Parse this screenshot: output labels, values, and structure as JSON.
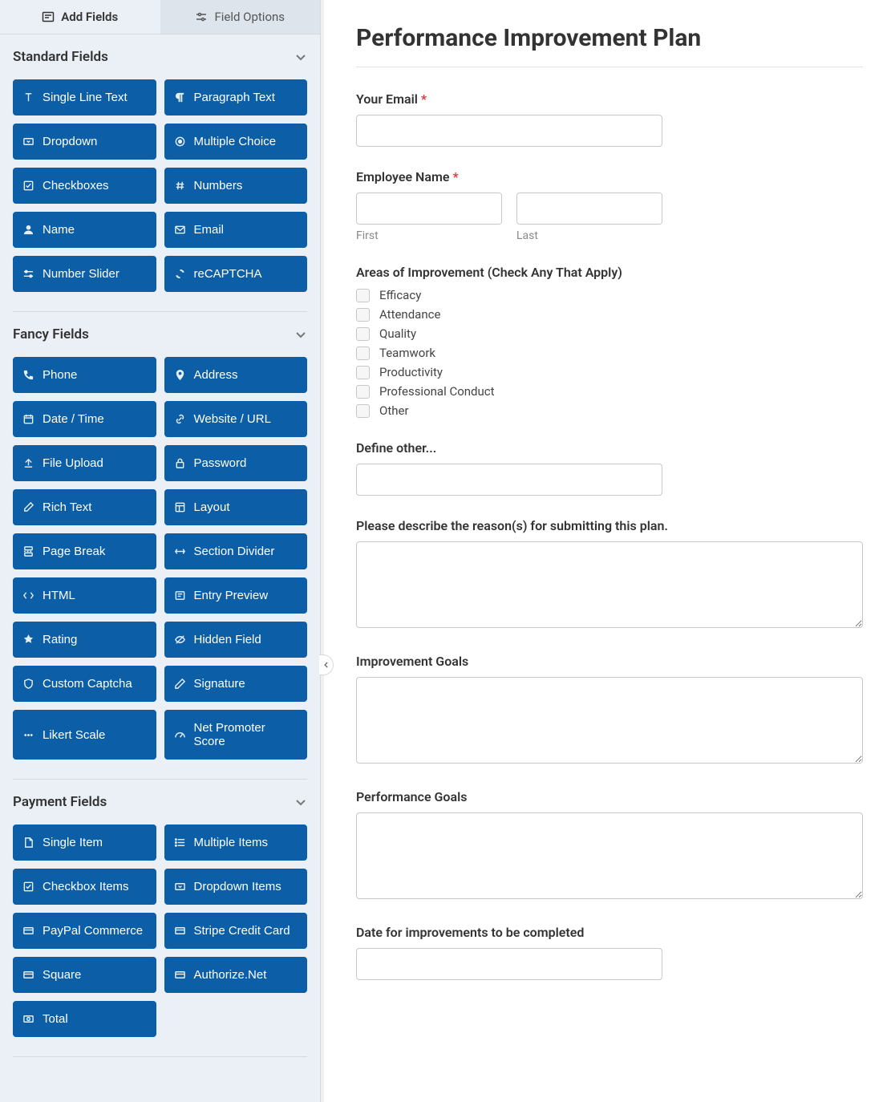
{
  "tabs": {
    "add_fields": "Add Fields",
    "field_options": "Field Options"
  },
  "sections": {
    "standard": {
      "title": "Standard Fields",
      "items": [
        "Single Line Text",
        "Paragraph Text",
        "Dropdown",
        "Multiple Choice",
        "Checkboxes",
        "Numbers",
        "Name",
        "Email",
        "Number Slider",
        "reCAPTCHA"
      ]
    },
    "fancy": {
      "title": "Fancy Fields",
      "items": [
        "Phone",
        "Address",
        "Date / Time",
        "Website / URL",
        "File Upload",
        "Password",
        "Rich Text",
        "Layout",
        "Page Break",
        "Section Divider",
        "HTML",
        "Entry Preview",
        "Rating",
        "Hidden Field",
        "Custom Captcha",
        "Signature",
        "Likert Scale",
        "Net Promoter Score"
      ]
    },
    "payment": {
      "title": "Payment Fields",
      "items": [
        "Single Item",
        "Multiple Items",
        "Checkbox Items",
        "Dropdown Items",
        "PayPal Commerce",
        "Stripe Credit Card",
        "Square",
        "Authorize.Net",
        "Total"
      ]
    }
  },
  "form": {
    "title": "Performance Improvement Plan",
    "email_label": "Your Email",
    "employee_label": "Employee Name",
    "first_sub": "First",
    "last_sub": "Last",
    "areas_label": "Areas of Improvement (Check Any That Apply)",
    "areas_options": [
      "Efficacy",
      "Attendance",
      "Quality",
      "Teamwork",
      "Productivity",
      "Professional Conduct",
      "Other"
    ],
    "define_other_label": "Define other...",
    "reason_label": "Please describe the reason(s) for submitting this plan.",
    "improvement_goals_label": "Improvement Goals",
    "performance_goals_label": "Performance Goals",
    "date_label": "Date for improvements to be completed"
  }
}
